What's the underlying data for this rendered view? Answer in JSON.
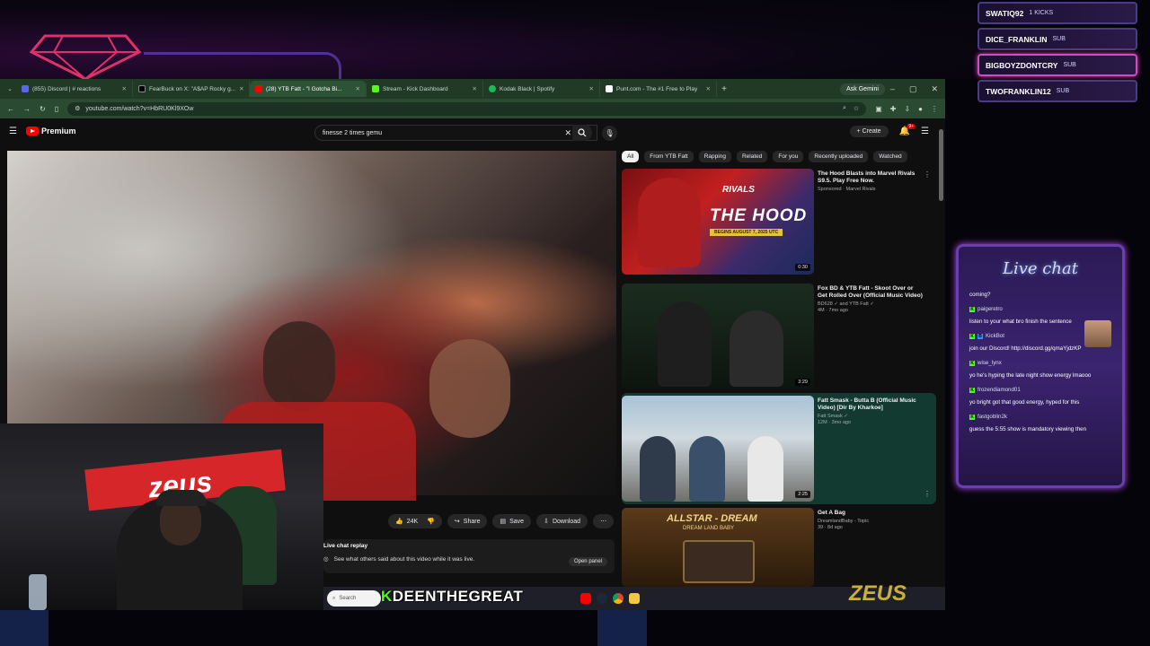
{
  "browser": {
    "tabs": [
      {
        "label": "(855) Discord | #⁠ reactions",
        "color": "#5865f2",
        "active": false
      },
      {
        "label": "FearBuck on X: \"A$AP Rocky g...",
        "color": "#000000",
        "active": false
      },
      {
        "label": "(28) YTB Fatt - \"I Gotcha Bi...",
        "color": "#ff0000",
        "active": true
      },
      {
        "label": "Stream - Kick Dashboard",
        "color": "#53fc18",
        "active": false
      },
      {
        "label": "Kodak Black | Spotify",
        "color": "#1db954",
        "active": false
      },
      {
        "label": "Punt.com - The #1 Free to Play",
        "color": "#ffffff",
        "active": false
      }
    ],
    "new_tab": "+",
    "gemini_label": "Ask Gemini",
    "url": "youtube.com/watch?v=HbRU0Kl9XOw",
    "win_controls": [
      "–",
      "▢",
      "✕"
    ]
  },
  "youtube": {
    "brand": "Premium",
    "search_value": "finesse 2 times gemu",
    "create_label": "+ Create",
    "notif_count": "9+",
    "actions": {
      "likes": "24K",
      "share": "Share",
      "save": "Save",
      "download": "Download"
    },
    "replay": {
      "title": "Live chat replay",
      "desc": "See what others said about this video while it was live.",
      "button": "Open panel"
    },
    "chips": [
      "All",
      "From YTB Fatt",
      "Rapping",
      "Related",
      "For you",
      "Recently uploaded",
      "Watched"
    ],
    "recommendations": [
      {
        "title": "The Hood Blasts into Marvel Rivals S9.5. Play Free Now.",
        "channel": "Sponsored · Marvel Rivals",
        "stats": "",
        "duration": "0:30",
        "thumb_text": "THE HOOD",
        "thumb_brand": "RIVALS",
        "thumb_sub": "BEGINS AUGUST 7, 2025 UTC"
      },
      {
        "title": "Fox BD & YTB Fatt - Skoot Over or Get Rolled Over (Official Music Video)",
        "channel": "BD628 ✓ and YTB Fatt ✓",
        "stats": "4M · 7mo ago",
        "duration": "3:29"
      },
      {
        "title": "Fatt Smask - Butta B (Official Music Video) [Dir By Kharkoe]",
        "channel": "Fatt Smask ✓",
        "stats": "12M · 3mo ago",
        "duration": "2:25"
      },
      {
        "title": "Get A Bag",
        "channel": "DreamlandBaby - Topic",
        "stats": "39 · 8d ago",
        "duration": "",
        "thumb_text": "ALLSTAR - DREAM",
        "thumb_sub": "DREAM LAND BABY"
      }
    ]
  },
  "taskbar": {
    "search": "Search",
    "kick_name_prefix": "K",
    "kick_name": "DEENTHEGREAT",
    "zeus_corner": "ZEUS"
  },
  "webcam": {
    "banner": "zeus"
  },
  "kicks": [
    {
      "name": "SWATIQ92",
      "tag": "1 KICKS",
      "active": false
    },
    {
      "name": "DICE_FRANKLIN",
      "tag": "SUB",
      "active": false
    },
    {
      "name": "BIGBOYZDONTCRY",
      "tag": "SUB",
      "active": true
    },
    {
      "name": "TWOFRANKLIN12",
      "tag": "SUB",
      "active": false
    }
  ],
  "chat": {
    "title": "Live chat",
    "messages": [
      {
        "user": "",
        "text": "coming?"
      },
      {
        "user": "paigeretro",
        "text": "listen to your what bro finish the sentence"
      },
      {
        "user": "KickBot",
        "text": "join our Discord! http://discord.gg/qmaYjdzKP"
      },
      {
        "user": "wise_lynx",
        "text": "yo he's hyping the late night show energy lmaooo"
      },
      {
        "user": "frozendiamond01",
        "text": "yo bright got that good energy, hyped for this"
      },
      {
        "user": "fastgoblin2k",
        "text": "guess the 5:55 show is mandatory viewing then"
      }
    ]
  },
  "colors": {
    "accent_purple": "#6b3fb0",
    "kick_green": "#53fc18",
    "yt_red": "#ff0000",
    "browser_green": "#203a26"
  }
}
